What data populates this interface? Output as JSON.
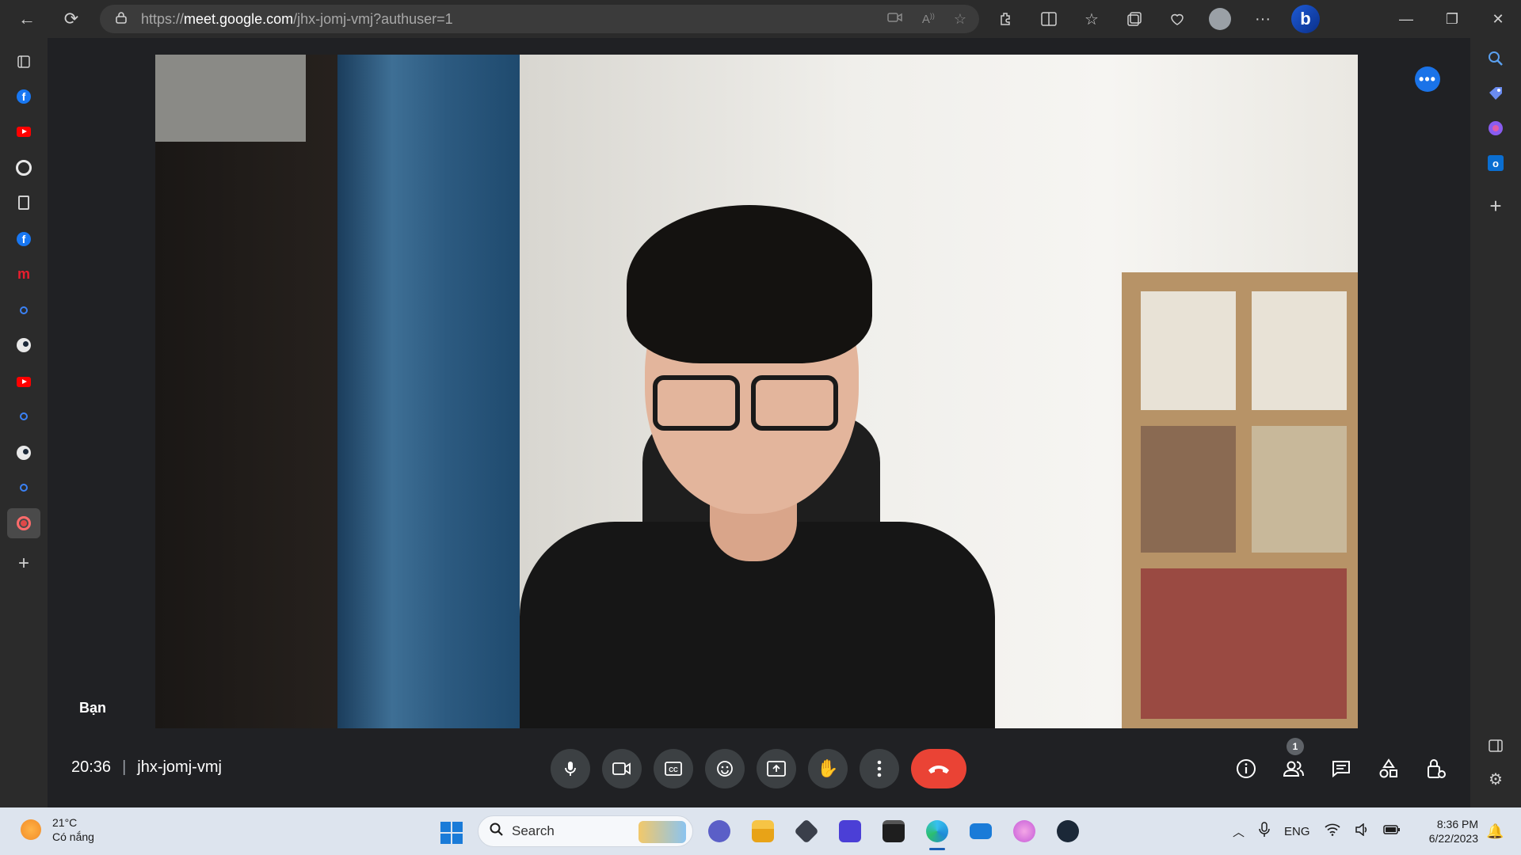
{
  "browser": {
    "url_prefix": "https://",
    "url_host": "meet.google.com",
    "url_path": "/jhx-jomj-vmj?authuser=1",
    "nav_icons": {
      "back": "←",
      "refresh": "⟳",
      "lock": "🔒"
    },
    "address_icons": [
      "video-icon",
      "read-aloud-icon",
      "star-icon"
    ],
    "toolbar_icons": [
      "extensions-icon",
      "split-screen-icon",
      "favorites-icon",
      "collections-icon",
      "browser-essentials-icon",
      "profile-avatar",
      "more-icon",
      "bing-icon"
    ],
    "window_controls": {
      "minimize": "—",
      "restore": "❐",
      "close": "✕"
    }
  },
  "left_sidebar": {
    "items": [
      "tabs-icon",
      "facebook-icon",
      "youtube-icon",
      "github-icon",
      "document-icon",
      "facebook-icon",
      "m-icon",
      "search-icon",
      "steam-icon",
      "youtube-icon",
      "search-icon",
      "steam-icon",
      "search-icon",
      "record-icon",
      "add-icon"
    ],
    "m_label": "m"
  },
  "right_sidebar": {
    "items": [
      "search-icon",
      "tag-icon",
      "copilot-icon",
      "outlook-icon",
      "add-icon",
      "sidebar-icon",
      "settings-icon"
    ],
    "outlook_letter": "o"
  },
  "meet": {
    "self_label": "Bạn",
    "time": "20:36",
    "meeting_code": "jhx-jomj-vmj",
    "participant_count": "1",
    "more_options_label": "•••",
    "controls": [
      "microphone-icon",
      "camera-icon",
      "captions-icon",
      "emoji-icon",
      "present-icon",
      "raise-hand-icon",
      "more-options-icon",
      "end-call-icon"
    ],
    "right_controls": [
      "info-icon",
      "people-icon",
      "chat-icon",
      "activities-icon",
      "host-controls-icon"
    ],
    "colors": {
      "end_call": "#ea4335",
      "more_button": "#1a73e8"
    }
  },
  "taskbar": {
    "weather_temp": "21°C",
    "weather_desc": "Có nắng",
    "search_label": "Search",
    "apps": [
      "teams-chat-icon",
      "file-explorer-icon",
      "app-cube-icon",
      "visual-studio-icon",
      "terminal-icon",
      "edge-icon",
      "mail-icon",
      "pink-app-icon",
      "steam-icon"
    ],
    "active_app": "edge-icon",
    "lang": "ENG",
    "time": "8:36 PM",
    "date": "6/22/2023"
  }
}
